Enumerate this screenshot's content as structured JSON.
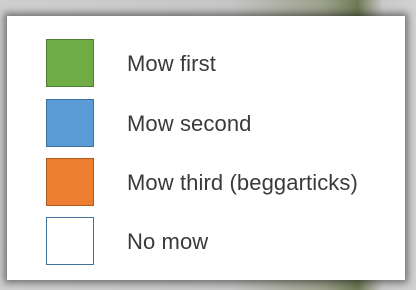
{
  "legend": {
    "items": [
      {
        "label": "Mow first",
        "swatch_color": "#70ad47",
        "border_color": "#507e32"
      },
      {
        "label": "Mow second",
        "swatch_color": "#5b9bd5",
        "border_color": "#41719c"
      },
      {
        "label": "Mow third (beggarticks)",
        "swatch_color": "#ed7d31",
        "border_color": "#ae5a21"
      },
      {
        "label": "No mow",
        "swatch_color": "#ffffff",
        "border_color": "#41719c"
      }
    ]
  }
}
